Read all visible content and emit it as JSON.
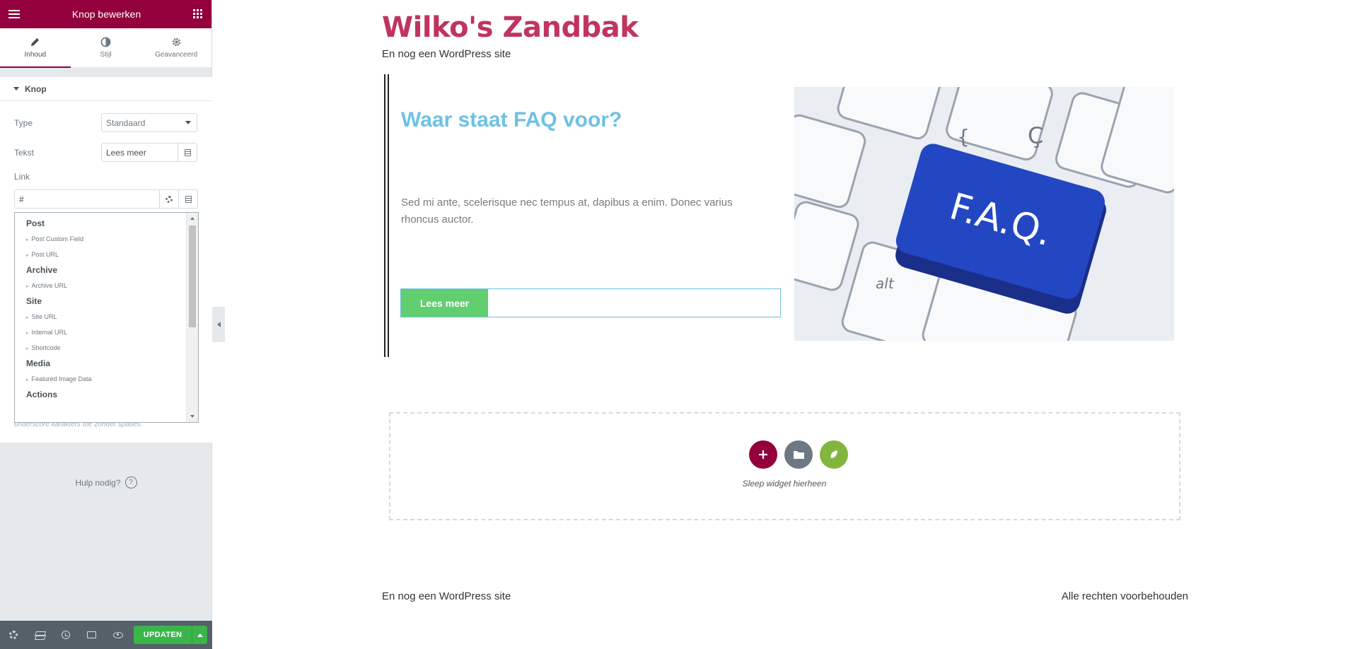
{
  "header": {
    "title": "Knop bewerken"
  },
  "tabs": [
    {
      "label": "Inhoud",
      "icon": "pencil-icon"
    },
    {
      "label": "Stijl",
      "icon": "contrast-icon"
    },
    {
      "label": "Geavanceerd",
      "icon": "gear-icon"
    }
  ],
  "section": {
    "title": "Knop"
  },
  "controls": {
    "type_label": "Type",
    "type_value": "Standaard",
    "text_label": "Tekst",
    "text_value": "Lees meer",
    "link_label": "Link",
    "link_value": "#"
  },
  "dropdown": {
    "items": [
      {
        "kind": "group",
        "label": "Post"
      },
      {
        "kind": "option",
        "label": "Post Custom Field"
      },
      {
        "kind": "option",
        "label": "Post URL"
      },
      {
        "kind": "group",
        "label": "Archive"
      },
      {
        "kind": "option",
        "label": "Archive URL"
      },
      {
        "kind": "group",
        "label": "Site"
      },
      {
        "kind": "option",
        "label": "Site URL"
      },
      {
        "kind": "option",
        "label": "Internal URL"
      },
      {
        "kind": "option",
        "label": "Shortcode"
      },
      {
        "kind": "group",
        "label": "Media"
      },
      {
        "kind": "option",
        "label": "Featured Image Data"
      },
      {
        "kind": "group",
        "label": "Actions"
      }
    ]
  },
  "hint": "underscore karakters toe zonder spaties.",
  "help": {
    "label": "Hulp nodig?"
  },
  "footer": {
    "update_label": "UPDATEN"
  },
  "preview": {
    "site_title": "Wilko's Zandbak",
    "tagline": "En nog een WordPress site",
    "faq_title": "Waar staat FAQ voor?",
    "faq_text": "Sed mi ante, scelerisque nec tempus at, dapibus a enim. Donec varius rhoncus auctor.",
    "button_label": "Lees meer",
    "image_text": "F.A.Q.",
    "dropzone_text": "Sleep widget hierheen",
    "footer_left": "En nog een WordPress site",
    "footer_right": "Alle rechten voorbehouden"
  },
  "colors": {
    "brand": "#93003c",
    "title": "#c0345e",
    "heading": "#6ec1e4",
    "button": "#61ce70",
    "update": "#39b54a"
  }
}
